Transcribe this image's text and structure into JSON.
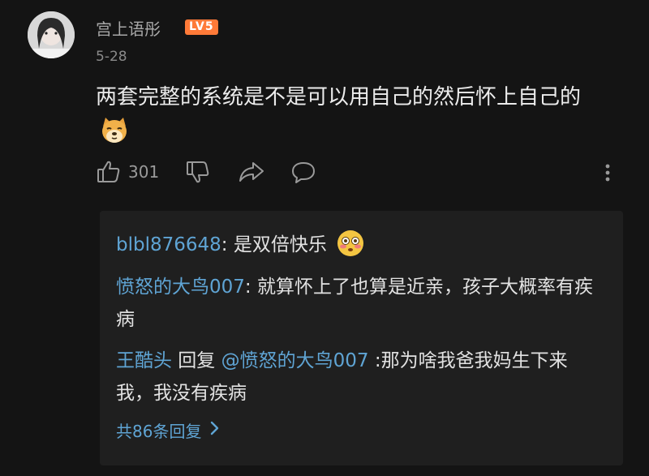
{
  "comment": {
    "username": "宫上语彤",
    "level": "LV5",
    "date": "5-28",
    "text": "两套完整的系统是不是可以用自己的然后怀上自己的",
    "emoji": "doge-emoji",
    "likes": "301"
  },
  "replies": [
    {
      "user": "blbl876648",
      "separator": ": ",
      "text": "是双倍快乐",
      "emoji": "flushed-emoji"
    },
    {
      "user": "愤怒的大鸟007",
      "separator": ": ",
      "text": "就算怀上了也算是近亲，孩子大概率有疾病"
    },
    {
      "user": "王酷头",
      "reply_word": " 回复 ",
      "mention": "@愤怒的大鸟007",
      "separator": " :",
      "text": "那为啥我爸我妈生下来我，我没有疾病"
    }
  ],
  "more_replies_label": "共86条回复",
  "colors": {
    "background": "#141414",
    "reply_panel": "#1f1f1f",
    "link": "#5fa4d4",
    "level_badge": "#ff7a38"
  },
  "icons": [
    "thumbs-up-icon",
    "thumbs-down-icon",
    "share-icon",
    "comment-icon",
    "more-vertical-icon",
    "chevron-right-icon"
  ]
}
